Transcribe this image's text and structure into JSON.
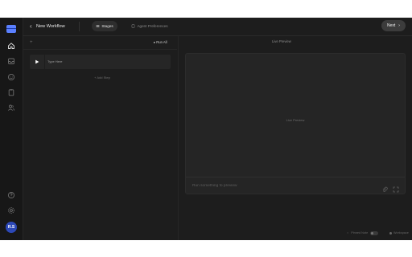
{
  "header": {
    "title": "New Workflow",
    "tabs": [
      {
        "label": "Stages",
        "active": true,
        "icon": "list-icon"
      },
      {
        "label": "Agent Preferences",
        "active": false,
        "icon": "document-icon"
      }
    ],
    "next_label": "Next"
  },
  "sidebar": {
    "items": [
      {
        "icon": "home-icon",
        "active": true
      },
      {
        "icon": "inbox-icon",
        "active": false
      },
      {
        "icon": "smile-icon",
        "active": false
      },
      {
        "icon": "clipboard-icon",
        "active": false
      },
      {
        "icon": "users-icon",
        "active": false
      },
      {
        "icon": "help-icon",
        "active": false
      },
      {
        "icon": "settings-icon",
        "active": false
      }
    ],
    "avatar_initials": "R.S"
  },
  "steps_panel": {
    "run_all_label": "Run All",
    "steps": [
      {
        "text": "Type Here",
        "icon": "play-icon"
      }
    ],
    "add_step_label": "+ Add Step"
  },
  "preview_panel": {
    "header": "Live Preview",
    "center_text": "Live Preview",
    "input_placeholder": "Run something to preview",
    "status_left": "Pinned Note",
    "status_right": "Workspace"
  },
  "colors": {
    "background": "#1d1d1d",
    "sidebar": "#171717",
    "accent": "#5b80ff",
    "avatar": "#2c48b8"
  }
}
